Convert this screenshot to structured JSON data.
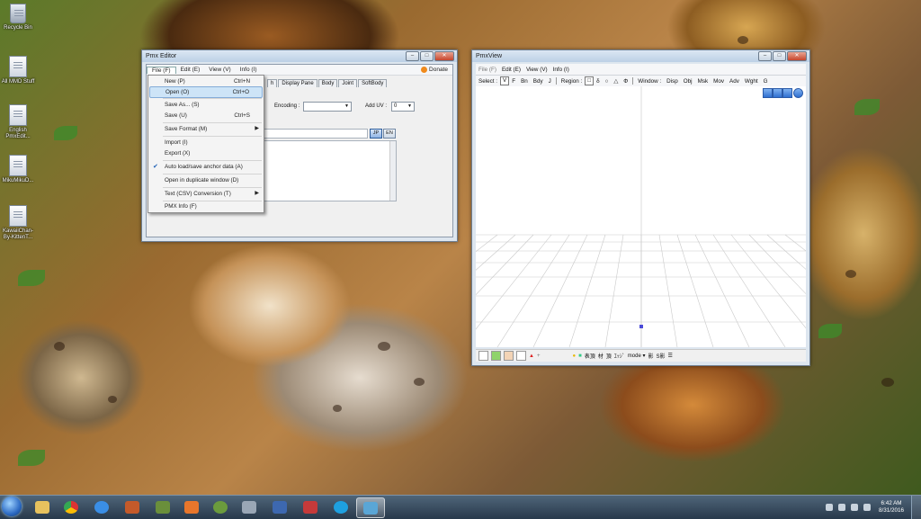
{
  "desktop": {
    "icons": [
      {
        "label": "Recycle Bin"
      },
      {
        "label": "All MMD Stuff"
      },
      {
        "label": "English PmxEdit..."
      },
      {
        "label": "MikuMikuD..."
      },
      {
        "label": "KawaiiChan-By-KittenT..."
      }
    ]
  },
  "pmx_editor": {
    "title": "Pmx Editor",
    "donate_label": "Donate",
    "menu": [
      "File (F)",
      "Edit (E)",
      "View (V)",
      "Info (I)"
    ],
    "tabs_partial": [
      "h",
      "Display Pane",
      "Body",
      "Joint",
      "SoftBody"
    ],
    "encoding_label": "Encoding :",
    "encoding_value": "",
    "add_uv_label": "Add UV :",
    "add_uv_value": "0",
    "lang_jp": "JP",
    "lang_en": "EN"
  },
  "file_menu": {
    "items": [
      {
        "label": "New (P)",
        "shortcut": "Ctrl+N"
      },
      {
        "label": "Open (O)",
        "shortcut": "Ctrl+O"
      },
      {
        "label": "Save As... (S)",
        "shortcut": ""
      },
      {
        "label": "Save (U)",
        "shortcut": "Ctrl+S"
      },
      {
        "label": "Save Format (M)",
        "shortcut": ""
      },
      {
        "label": "Import (I)",
        "shortcut": ""
      },
      {
        "label": "Export (X)",
        "shortcut": ""
      },
      {
        "label": "Auto load/save anchor data (A)",
        "shortcut": ""
      },
      {
        "label": "Open in duplicate window (D)",
        "shortcut": ""
      },
      {
        "label": "Text (CSV) Conversion (T)",
        "shortcut": ""
      },
      {
        "label": "PMX Info (F)",
        "shortcut": ""
      }
    ]
  },
  "pmx_view": {
    "title": "PmxView",
    "menu": [
      "File (F)",
      "Edit (E)",
      "View (V)",
      "Info (I)"
    ],
    "select_label": "Select :",
    "select_items": [
      "V",
      "F",
      "Bn",
      "Bdy",
      "J"
    ],
    "region_label": "Region :",
    "window_label": "Window :",
    "window_items": [
      "Disp",
      "Obj",
      "Msk",
      "Mov",
      "Adv",
      "Wght",
      "G"
    ],
    "bottom_items": [
      "表頂",
      "材",
      "頂",
      "ｴｯｼﾞ",
      "mode ▾",
      "影",
      "S影"
    ]
  },
  "taskbar": {
    "time": "6:42 AM",
    "date": "8/31/2016"
  }
}
